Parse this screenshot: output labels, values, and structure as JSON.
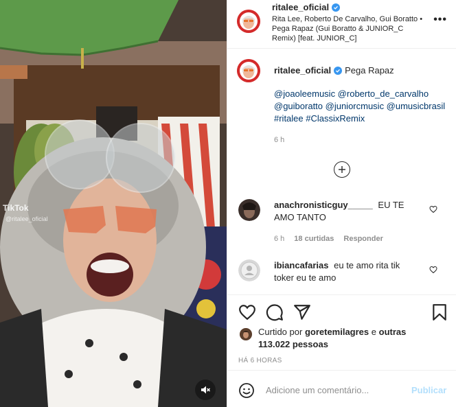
{
  "video": {
    "watermark_brand": "TikTok",
    "watermark_handle": "@ritalee_oficial",
    "mute_icon": "speaker-muted-icon"
  },
  "header": {
    "username": "ritalee_oficial",
    "verified_icon": "verified-badge-icon",
    "music": "Rita Lee, Roberto De Carvalho, Gui Boratto • Pega Rapaz (Gui Boratto & JUNIOR_C Remix) [feat. JUNIOR_C]",
    "more_label": "•••"
  },
  "caption": {
    "username": "ritalee_oficial",
    "text": "Pega Rapaz",
    "tags": "@joaoleemusic @roberto_de_carvalho @guiboratto @juniorcmusic @umusicbrasil #ritalee #ClassixRemix",
    "time": "6 h"
  },
  "load_more_icon": "plus-circle-icon",
  "comments": [
    {
      "username": "anachronisticguy_____",
      "text": "EU TE AMO TANTO",
      "time": "6 h",
      "likes": "18 curtidas",
      "reply": "Responder"
    },
    {
      "username": "ibiancafarias",
      "text": "eu te amo rita tik toker eu te amo"
    }
  ],
  "actions": {
    "icons": [
      "heart-icon",
      "comment-icon",
      "share-icon",
      "bookmark-icon"
    ],
    "likes_prefix": "Curtido por",
    "likes_user": "goretemilagres",
    "likes_mid": "e",
    "likes_others": "outras 113.022 pessoas",
    "post_time": "HÁ 6 HORAS"
  },
  "add_comment": {
    "placeholder": "Adicione um comentário...",
    "publish": "Publicar"
  },
  "colors": {
    "link": "#00376b",
    "verified": "#3897f0",
    "publish_disabled": "#b2dffc",
    "muted_text": "#8e8e8e"
  }
}
